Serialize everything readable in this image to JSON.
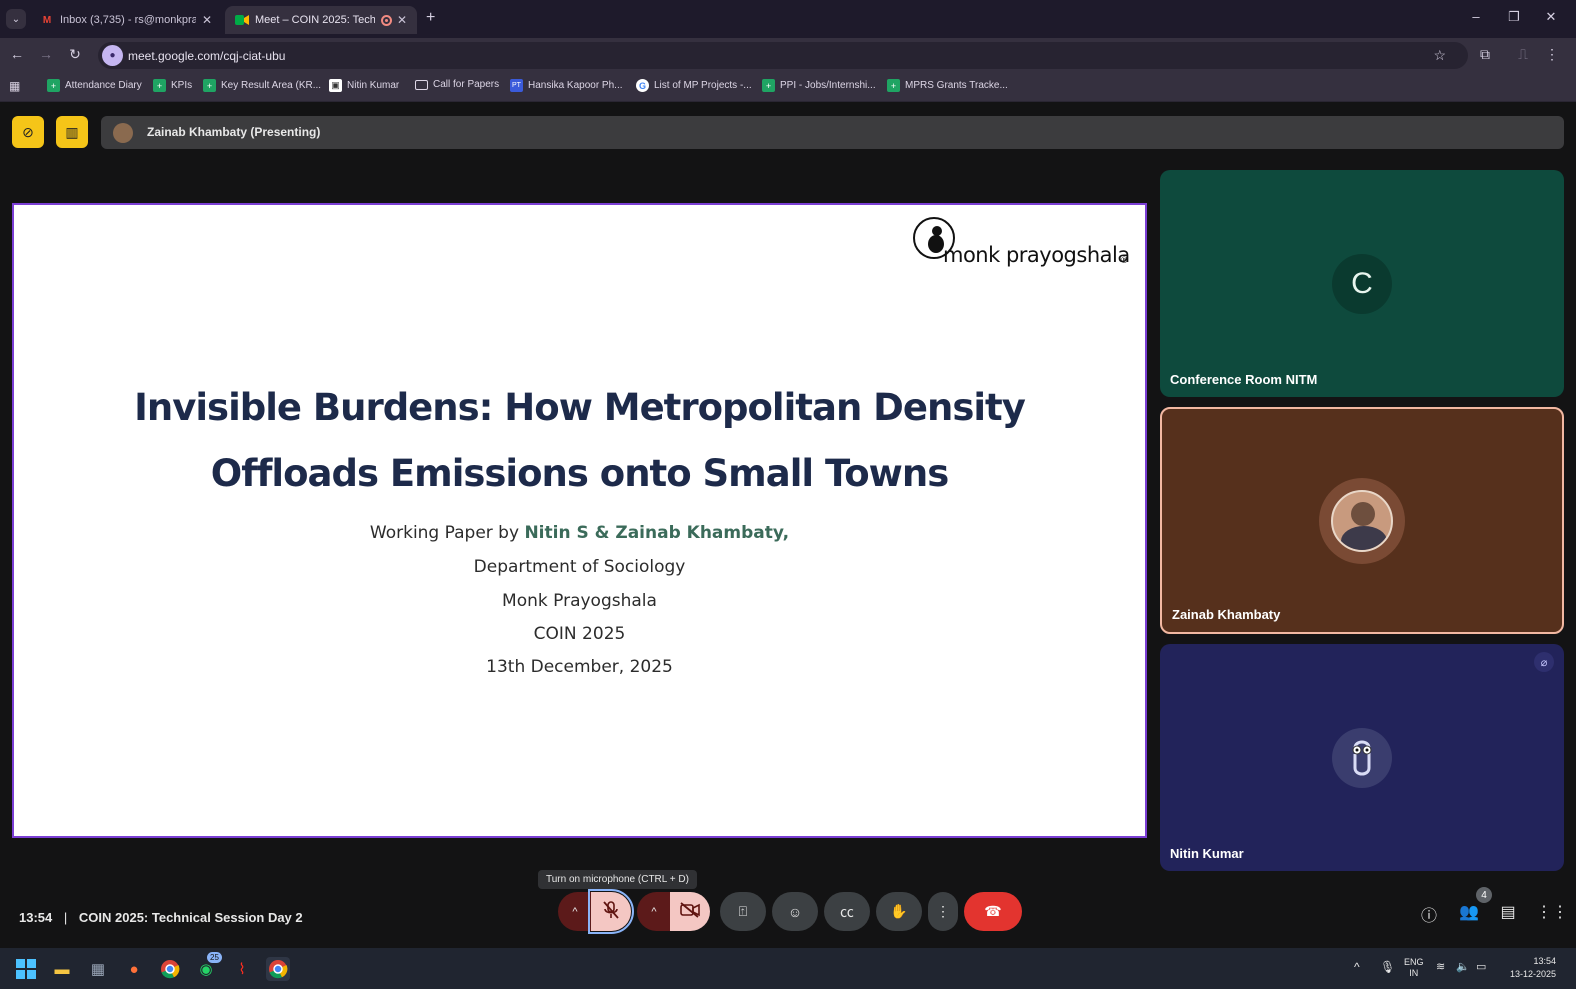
{
  "browser": {
    "tabs": [
      {
        "label": "Inbox (3,735) - rs@monkprayo",
        "icon": "gmail-icon"
      },
      {
        "label": "Meet – COIN 2025: Technic",
        "icon": "meet-icon",
        "active": true
      }
    ],
    "new_tab": "+",
    "url": "meet.google.com/cqj-ciat-ubu",
    "bookmarks": [
      {
        "label": "Attendance Diary",
        "icon": "sheets-icon"
      },
      {
        "label": "KPIs",
        "icon": "sheets-icon"
      },
      {
        "label": "Key Result Area (KR...",
        "icon": "sheets-icon"
      },
      {
        "label": "Nitin Kumar",
        "icon": "page-icon"
      },
      {
        "label": "Call for Papers",
        "icon": "folder-icon"
      },
      {
        "label": "Hansika Kapoor Ph...",
        "icon": "pt-icon"
      },
      {
        "label": "List of MP Projects -...",
        "icon": "google-icon"
      },
      {
        "label": "PPI - Jobs/Internshi...",
        "icon": "sheets-icon"
      },
      {
        "label": "MPRS Grants Tracke...",
        "icon": "sheets-icon"
      }
    ]
  },
  "meet": {
    "presenting_label": "Zainab Khambaty (Presenting)",
    "slide": {
      "logo_text": "monk prayogshala",
      "logo_mark": "®",
      "title_line1": "Invisible Burdens: How Metropolitan Density",
      "title_line2": "Offloads Emissions onto Small Towns",
      "byline_prefix": "Working Paper by ",
      "authors": "Nitin S & Zainab Khambaty,",
      "department": "Department of Sociology",
      "institution": "Monk Prayogshala",
      "event": "COIN 2025",
      "date": "13th December, 2025"
    },
    "participants": [
      {
        "name": "Conference Room NITM",
        "initial": "C",
        "color": "#0f4a3e"
      },
      {
        "name": "Zainab Khambaty",
        "color": "#5a311d",
        "speaking": true
      },
      {
        "name": "Nitin Kumar",
        "color": "#23235a",
        "muted": true
      }
    ],
    "time": "13:54",
    "meeting_title": "COIN 2025: Technical Session Day 2",
    "tooltip": "Turn on microphone (CTRL + D)",
    "people_count": "4"
  },
  "taskbar": {
    "whatsapp_badge": "25",
    "lang_line1": "ENG",
    "lang_line2": "IN",
    "clock_time": "13:54",
    "clock_date": "13-12-2025"
  },
  "colors": {
    "accent_purple": "#7b3fd4",
    "title_navy": "#1d2a4a",
    "author_green": "#3b6b5a",
    "hangup_red": "#e3342f",
    "mic_off_bg": "#f4c7c3"
  }
}
